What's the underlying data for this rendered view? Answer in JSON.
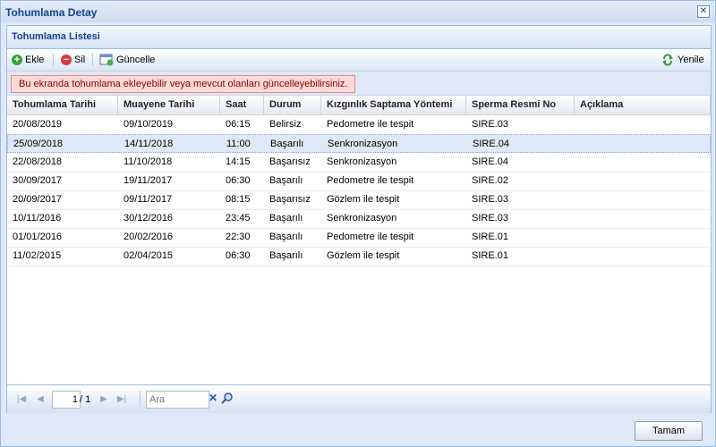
{
  "window": {
    "title": "Tohumlama Detay"
  },
  "panel": {
    "title": "Tohumlama Listesi"
  },
  "toolbar": {
    "add_label": "Ekle",
    "delete_label": "Sil",
    "update_label": "Güncelle",
    "refresh_label": "Yenile"
  },
  "message": "Bu ekranda tohumlama ekleyebilir veya mevcut olanları güncelleyebilirsiniz.",
  "columns": [
    "Tohumlama Tarihi",
    "Muayene Tarihi",
    "Saat",
    "Durum",
    "Kızgınlık Saptama Yöntemi",
    "Sperma Resmi No",
    "Açıklama"
  ],
  "rows": [
    [
      "20/08/2019",
      "09/10/2019",
      "06:15",
      "Belirsiz",
      "Pedometre ile tespit",
      "SIRE.03",
      ""
    ],
    [
      "25/09/2018",
      "14/11/2018",
      "11:00",
      "Başarılı",
      "Senkronizasyon",
      "SIRE.04",
      ""
    ],
    [
      "22/08/2018",
      "11/10/2018",
      "14:15",
      "Başarısız",
      "Senkronizasyon",
      "SIRE.04",
      ""
    ],
    [
      "30/09/2017",
      "19/11/2017",
      "06:30",
      "Başarılı",
      "Pedometre ile tespit",
      "SIRE.02",
      ""
    ],
    [
      "20/09/2017",
      "09/11/2017",
      "08:15",
      "Başarısız",
      "Gözlem ile tespit",
      "SIRE.03",
      ""
    ],
    [
      "10/11/2016",
      "30/12/2016",
      "23:45",
      "Başarılı",
      "Senkronizasyon",
      "SIRE.03",
      ""
    ],
    [
      "01/01/2016",
      "20/02/2016",
      "22:30",
      "Başarılı",
      "Pedometre ile tespit",
      "SIRE.01",
      ""
    ],
    [
      "11/02/2015",
      "02/04/2015",
      "06:30",
      "Başarılı",
      "Gözlem ile tespit",
      "SIRE.01",
      ""
    ]
  ],
  "selected_row": 1,
  "pager": {
    "page": "1",
    "of": "/ 1",
    "search_placeholder": "Ara"
  },
  "footer": {
    "ok_label": "Tamam"
  },
  "colors": {
    "add": "#3aa43a",
    "delete": "#d83a3a",
    "refresh": "#3a9a3a",
    "title": "#15428b",
    "message_bg": "#fbd8d8"
  }
}
